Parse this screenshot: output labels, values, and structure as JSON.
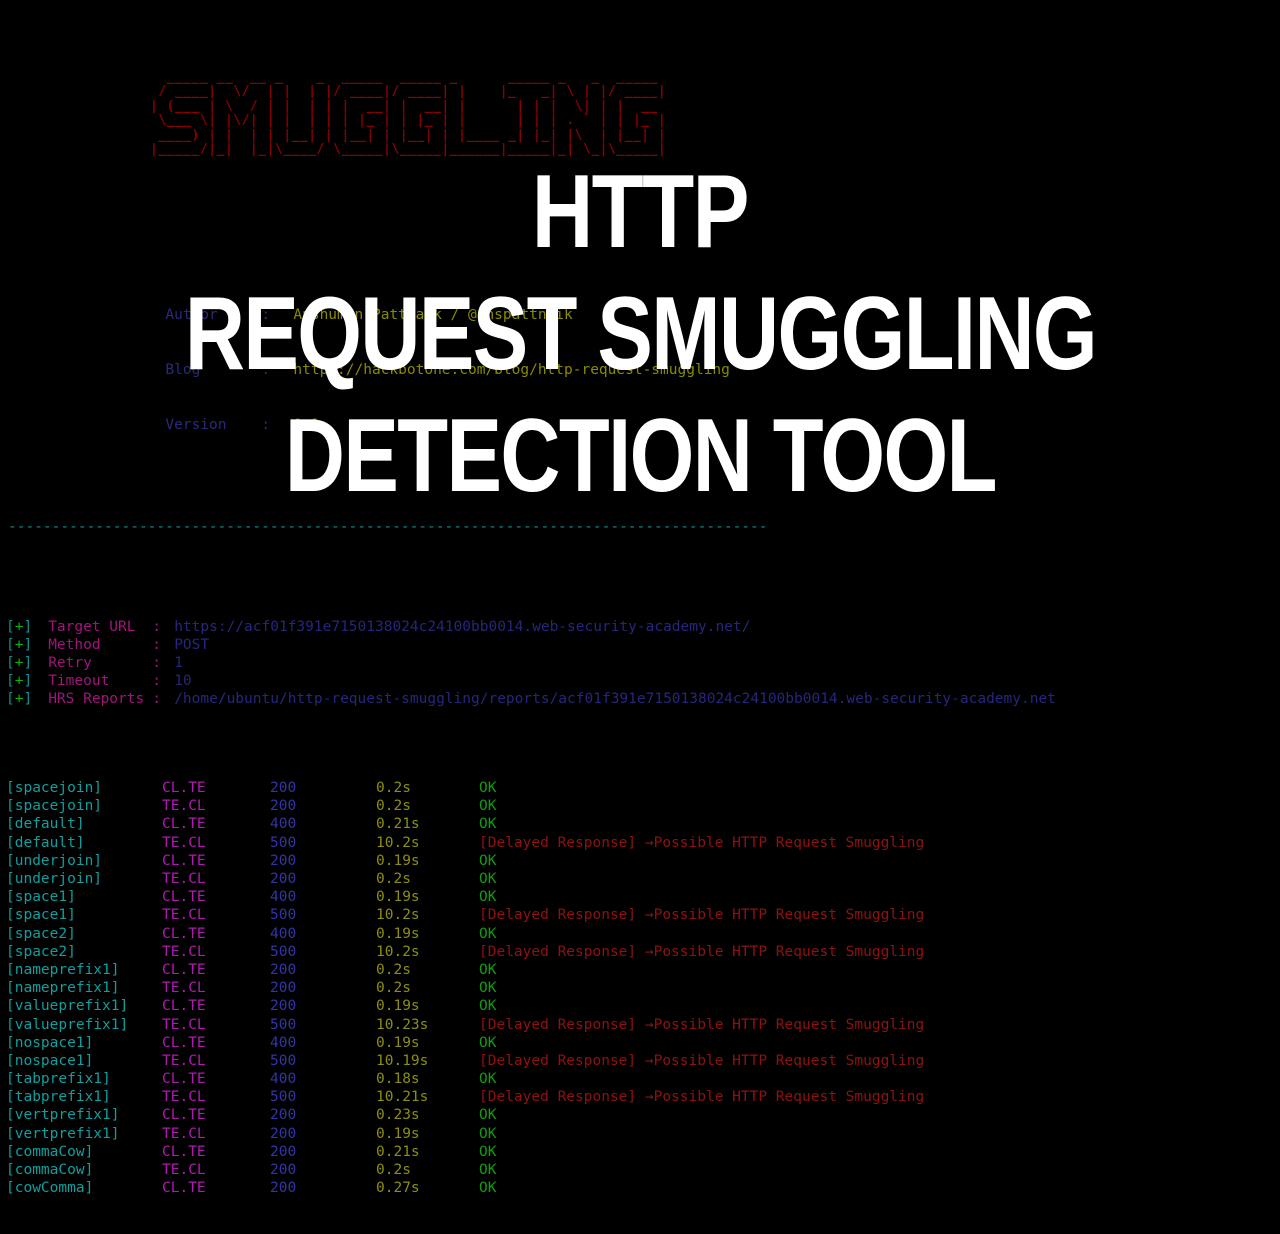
{
  "banner": {
    "ascii_text": "SMUGGLING",
    "ascii_art": "  _____ __  __ _    _  _____  _____ _      _____ _   _  _____ \n / ____|  \\/  | |  | |/ ____|/ ____| |    |_   _| \\ | |/ ____|\n| (___ | \\  / | |  | | |  __| |  __| |      | | |  \\| | |  __ \n \\___ \\| |\\/| | |  | | | |_ | | |_ | |      | | | . ` | | |_ |\n ____) | |  | | |__| | |__| | |__| | |____ _| |_| |\\  | |__| |\n|_____/|_|  |_|\\____/ \\_____|\\_____|______|_____|_| \\_|\\_____|",
    "color": "#8b0000"
  },
  "meta": {
    "rows": [
      {
        "label": "Author",
        "colon": ":",
        "value": "Anshuman Pattnaik / @anspattnaik"
      },
      {
        "label": "Blog",
        "colon": ":",
        "value": "https://hackbotone.com/blog/http-request-smuggling"
      },
      {
        "label": "Version",
        "colon": ":",
        "value": "0.1"
      }
    ],
    "label_color": "#2a2a7a",
    "value_color": "#8a8a00"
  },
  "divider": {
    "text": "----------------------------------------------------------------------------------------------",
    "color": "#0d8f8f"
  },
  "info": {
    "marker_open": "[",
    "marker_plus": "+",
    "marker_close": "]",
    "rows": [
      {
        "label": "Target URL",
        "colon": ":",
        "value": "https://acf01f391e7150138024c24100bb0014.web-security-academy.net/"
      },
      {
        "label": "Method",
        "colon": ":",
        "value": "POST"
      },
      {
        "label": "Retry",
        "colon": ":",
        "value": "1"
      },
      {
        "label": "Timeout",
        "colon": ":",
        "value": "10"
      },
      {
        "label": "HRS Reports",
        "colon": ":",
        "value": "/home/ubuntu/http-request-smuggling/reports/acf01f391e7150138024c24100bb0014.web-security-academy.net"
      }
    ],
    "label_color": "#a1147c",
    "value_color": "#26267d"
  },
  "results": {
    "status_ok": "OK",
    "status_danger": "[Delayed Response] →Possible HTTP Request Smuggling",
    "rows": [
      {
        "name": "[spacejoin]",
        "technique": "CL.TE",
        "code": "200",
        "time": "0.2s",
        "status": "OK",
        "danger": false
      },
      {
        "name": "[spacejoin]",
        "technique": "TE.CL",
        "code": "200",
        "time": "0.2s",
        "status": "OK",
        "danger": false
      },
      {
        "name": "[default]",
        "technique": "CL.TE",
        "code": "400",
        "time": "0.21s",
        "status": "OK",
        "danger": false
      },
      {
        "name": "[default]",
        "technique": "TE.CL",
        "code": "500",
        "time": "10.2s",
        "status": "[Delayed Response] →Possible HTTP Request Smuggling",
        "danger": true
      },
      {
        "name": "[underjoin]",
        "technique": "CL.TE",
        "code": "200",
        "time": "0.19s",
        "status": "OK",
        "danger": false
      },
      {
        "name": "[underjoin]",
        "technique": "TE.CL",
        "code": "200",
        "time": "0.2s",
        "status": "OK",
        "danger": false
      },
      {
        "name": "[space1]",
        "technique": "CL.TE",
        "code": "400",
        "time": "0.19s",
        "status": "OK",
        "danger": false
      },
      {
        "name": "[space1]",
        "technique": "TE.CL",
        "code": "500",
        "time": "10.2s",
        "status": "[Delayed Response] →Possible HTTP Request Smuggling",
        "danger": true
      },
      {
        "name": "[space2]",
        "technique": "CL.TE",
        "code": "400",
        "time": "0.19s",
        "status": "OK",
        "danger": false
      },
      {
        "name": "[space2]",
        "technique": "TE.CL",
        "code": "500",
        "time": "10.2s",
        "status": "[Delayed Response] →Possible HTTP Request Smuggling",
        "danger": true
      },
      {
        "name": "[nameprefix1]",
        "technique": "CL.TE",
        "code": "200",
        "time": "0.2s",
        "status": "OK",
        "danger": false
      },
      {
        "name": "[nameprefix1]",
        "technique": "TE.CL",
        "code": "200",
        "time": "0.2s",
        "status": "OK",
        "danger": false
      },
      {
        "name": "[valueprefix1]",
        "technique": "CL.TE",
        "code": "200",
        "time": "0.19s",
        "status": "OK",
        "danger": false
      },
      {
        "name": "[valueprefix1]",
        "technique": "TE.CL",
        "code": "500",
        "time": "10.23s",
        "status": "[Delayed Response] →Possible HTTP Request Smuggling",
        "danger": true
      },
      {
        "name": "[nospace1]",
        "technique": "CL.TE",
        "code": "400",
        "time": "0.19s",
        "status": "OK",
        "danger": false
      },
      {
        "name": "[nospace1]",
        "technique": "TE.CL",
        "code": "500",
        "time": "10.19s",
        "status": "[Delayed Response] →Possible HTTP Request Smuggling",
        "danger": true
      },
      {
        "name": "[tabprefix1]",
        "technique": "CL.TE",
        "code": "400",
        "time": "0.18s",
        "status": "OK",
        "danger": false
      },
      {
        "name": "[tabprefix1]",
        "technique": "TE.CL",
        "code": "500",
        "time": "10.21s",
        "status": "[Delayed Response] →Possible HTTP Request Smuggling",
        "danger": true
      },
      {
        "name": "[vertprefix1]",
        "technique": "CL.TE",
        "code": "200",
        "time": "0.23s",
        "status": "OK",
        "danger": false
      },
      {
        "name": "[vertprefix1]",
        "technique": "TE.CL",
        "code": "200",
        "time": "0.19s",
        "status": "OK",
        "danger": false
      },
      {
        "name": "[commaCow]",
        "technique": "CL.TE",
        "code": "200",
        "time": "0.21s",
        "status": "OK",
        "danger": false
      },
      {
        "name": "[commaCow]",
        "technique": "TE.CL",
        "code": "200",
        "time": "0.2s",
        "status": "OK",
        "danger": false
      },
      {
        "name": "[cowComma]",
        "technique": "CL.TE",
        "code": "200",
        "time": "0.27s",
        "status": "OK",
        "danger": false
      }
    ],
    "name_color": "#109e9e",
    "technique_color": "#b318b3",
    "code_color": "#3434a8",
    "time_color": "#8d8d13",
    "ok_color": "#149a14",
    "danger_color": "#8f1212"
  },
  "overlay_title": {
    "line1": "HTTP",
    "line2": "REQUEST SMUGGLING",
    "line3": "DETECTION TOOL",
    "color": "#ffffff"
  }
}
